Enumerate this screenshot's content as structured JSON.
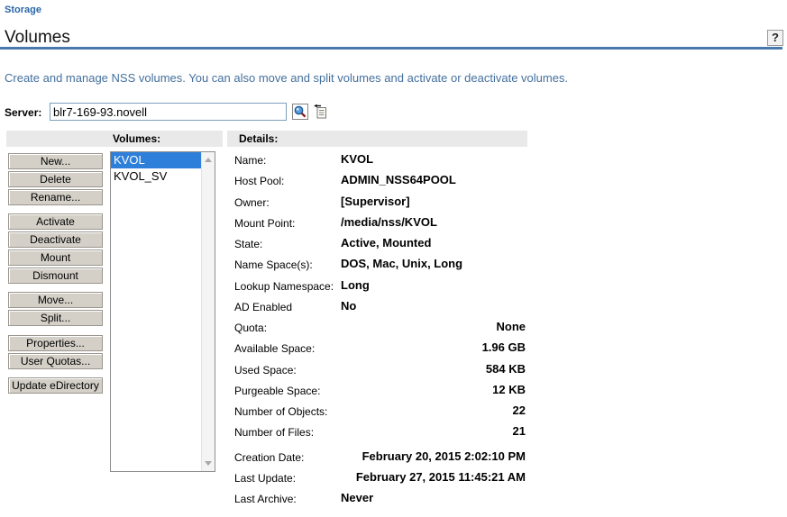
{
  "breadcrumb": {
    "label": "Storage"
  },
  "page": {
    "title": "Volumes"
  },
  "help": {
    "label": "?"
  },
  "intro": {
    "text": "Create and manage NSS volumes. You can also move and split volumes and activate or deactivate volumes."
  },
  "server": {
    "label": "Server:",
    "value": "blr7-169-93.novell"
  },
  "toolbar": {
    "buttons": [
      {
        "label": "New..."
      },
      {
        "label": "Delete"
      },
      {
        "label": "Rename..."
      },
      {
        "label": "Activate"
      },
      {
        "label": "Deactivate"
      },
      {
        "label": "Mount"
      },
      {
        "label": "Dismount"
      },
      {
        "label": "Move..."
      },
      {
        "label": "Split..."
      },
      {
        "label": "Properties..."
      },
      {
        "label": "User Quotas..."
      },
      {
        "label": "Update eDirectory"
      }
    ]
  },
  "volumes_list": {
    "header": "Volumes:",
    "items": [
      {
        "name": "KVOL",
        "selected": true
      },
      {
        "name": "KVOL_SV",
        "selected": false
      }
    ]
  },
  "details": {
    "header": "Details:",
    "rows": [
      {
        "label": "Name:",
        "value": "KVOL",
        "align": "left"
      },
      {
        "label": "Host Pool:",
        "value": "ADMIN_NSS64POOL",
        "align": "left"
      },
      {
        "label": "Owner:",
        "value": "[Supervisor]",
        "align": "left"
      },
      {
        "label": "Mount Point:",
        "value": "/media/nss/KVOL",
        "align": "left"
      },
      {
        "label": "State:",
        "value": "Active, Mounted",
        "align": "left"
      },
      {
        "label": "Name Space(s):",
        "value": "DOS, Mac, Unix, Long",
        "align": "left"
      },
      {
        "label": "Lookup Namespace:",
        "value": "Long",
        "align": "left"
      },
      {
        "label": "AD Enabled",
        "value": "No",
        "align": "left"
      },
      {
        "label": "Quota:",
        "value": "None",
        "align": "right"
      },
      {
        "label": "Available Space:",
        "value": "1.96 GB",
        "align": "right"
      },
      {
        "label": "Used Space:",
        "value": "584 KB",
        "align": "right"
      },
      {
        "label": "Purgeable Space:",
        "value": "12 KB",
        "align": "right"
      },
      {
        "label": "Number of Objects:",
        "value": "22",
        "align": "right"
      },
      {
        "label": "Number of Files:",
        "value": "21",
        "align": "right"
      },
      {
        "label": "Creation Date:",
        "value": "February 20, 2015 2:02:10 PM",
        "align": "right"
      },
      {
        "label": "Last Update:",
        "value": "February 27, 2015 11:45:21 AM",
        "align": "right"
      },
      {
        "label": "Last Archive:",
        "value": "Never",
        "align": "left"
      }
    ]
  },
  "colors": {
    "accent_rule": "#4a7aad",
    "link_blue": "#2a66a8",
    "intro_text": "#44709d",
    "selection_blue": "#2e7fd9",
    "band_gray": "#e9e9e9",
    "button_face": "#d4d0c8"
  }
}
